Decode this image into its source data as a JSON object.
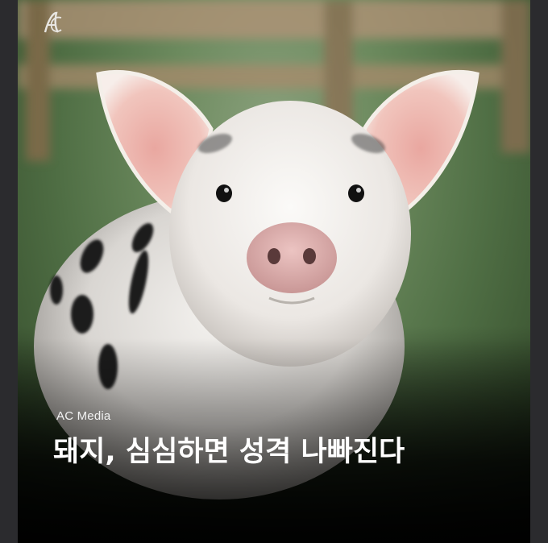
{
  "article": {
    "source": "AC Media",
    "headline": "돼지, 심심하면 성격 나빠진다"
  },
  "image": {
    "subject": "pig",
    "brand_mark": "AC"
  },
  "colors": {
    "frame": "#2b2b2e",
    "text": "#ffffff",
    "grass": "#4f6e44"
  }
}
